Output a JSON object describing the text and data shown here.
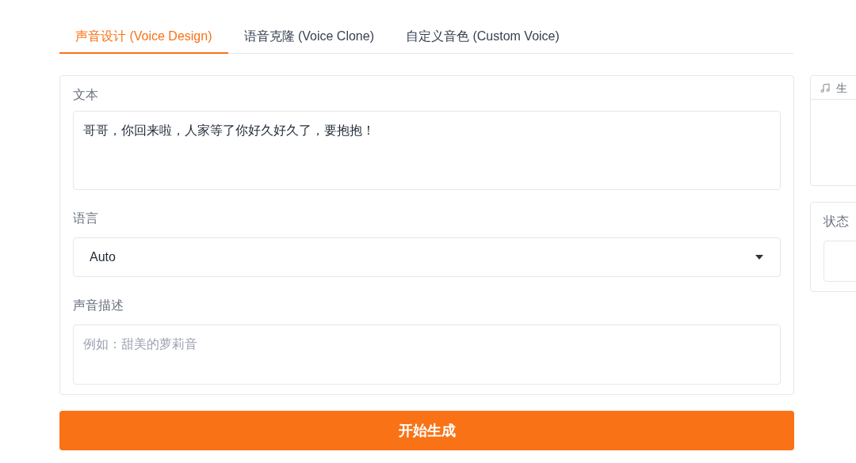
{
  "tabs": [
    {
      "label": "声音设计 (Voice Design)",
      "selected": true
    },
    {
      "label": "语音克隆 (Voice Clone)",
      "selected": false
    },
    {
      "label": "自定义音色 (Custom Voice)",
      "selected": false
    }
  ],
  "form": {
    "text": {
      "label": "文本",
      "value": "哥哥，你回来啦，人家等了你好久好久了，要抱抱！"
    },
    "language": {
      "label": "语言",
      "value": "Auto"
    },
    "description": {
      "label": "声音描述",
      "placeholder": "例如：甜美的萝莉音"
    }
  },
  "generate_button": "开始生成",
  "output": {
    "audio_label": "生",
    "status_label": "状态"
  }
}
